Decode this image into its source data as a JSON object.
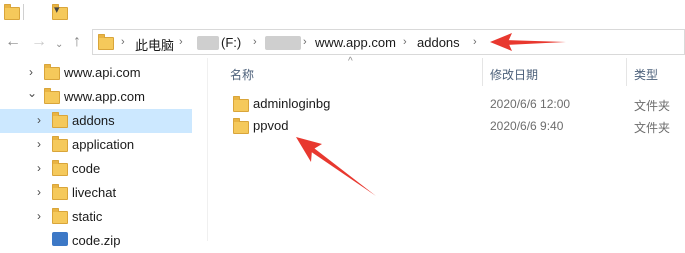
{
  "titlebar": {
    "dropdown_glyph": "▾"
  },
  "address": {
    "crumbs": [
      "此电脑",
      "(F:)",
      "www.app.com",
      "addons"
    ],
    "separator": "›",
    "dropdown_glyph": "›"
  },
  "nav": {
    "items": [
      {
        "label": "www.api.com",
        "chevron": "›"
      },
      {
        "label": "www.app.com",
        "chevron": "⌄"
      },
      {
        "label": "addons",
        "chevron": "›"
      },
      {
        "label": "application",
        "chevron": "›"
      },
      {
        "label": "code",
        "chevron": "›"
      },
      {
        "label": "livechat",
        "chevron": "›"
      },
      {
        "label": "static",
        "chevron": "›"
      },
      {
        "label": "code.zip",
        "chevron": ""
      }
    ]
  },
  "columns": {
    "name": "名称",
    "modified": "修改日期",
    "type": "类型",
    "sort_glyph": "^"
  },
  "files": [
    {
      "name": "adminloginbg",
      "modified": "2020/6/6 12:00",
      "type": "文件夹"
    },
    {
      "name": "ppvod",
      "modified": "2020/6/6 9:40",
      "type": "文件夹"
    }
  ],
  "colors": {
    "selection": "#cce8ff",
    "folder": "#f5c95b",
    "annotation_arrow": "#e8382f"
  }
}
